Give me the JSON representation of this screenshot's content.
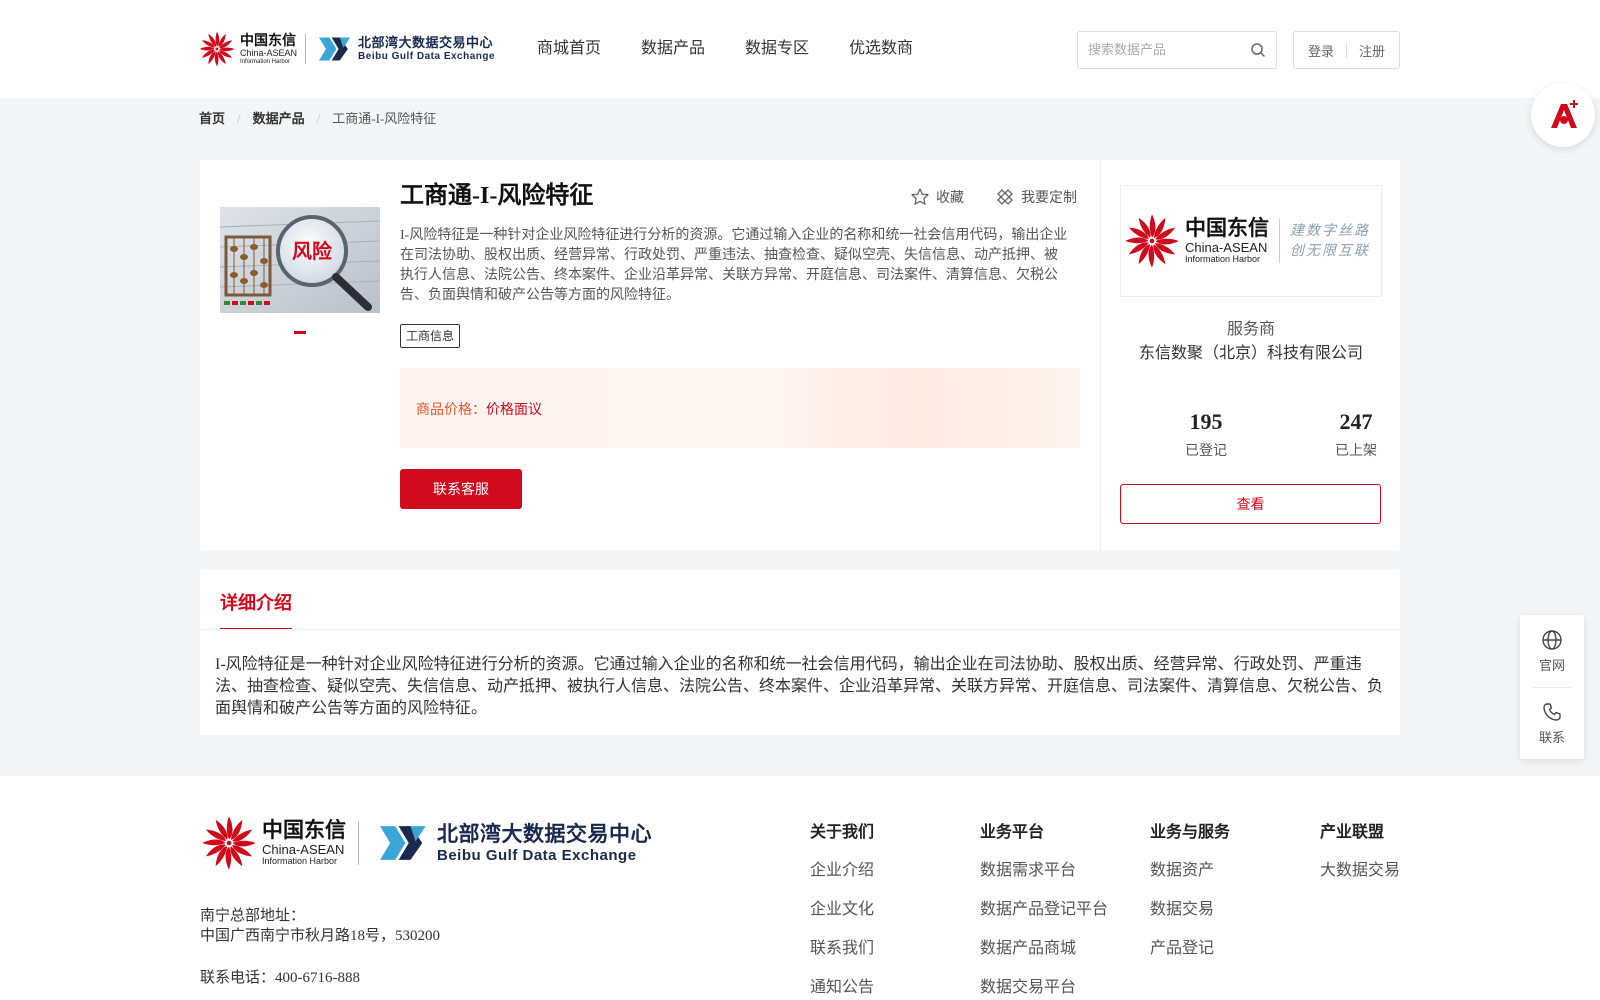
{
  "header": {
    "logo_cdx": {
      "cn": "中国东信",
      "en1": "China-ASEAN",
      "en2": "Information Harbor"
    },
    "logo_bbx": {
      "cn": "北部湾大数据交易中心",
      "en": "Beibu Gulf Data Exchange"
    },
    "nav": [
      "商城首页",
      "数据产品",
      "数据专区",
      "优选数商"
    ],
    "search_placeholder": "搜索数据产品",
    "login": "登录",
    "register": "注册"
  },
  "breadcrumb": {
    "home": "首页",
    "level1": "数据产品",
    "current": "工商通-I-风险特征",
    "separator": "/"
  },
  "product": {
    "title": "工商通-I-风险特征",
    "image_text": "风险",
    "favorite": "收藏",
    "customize": "我要定制",
    "description": "I-风险特征是一种针对企业风险特征进行分析的资源。它通过输入企业的名称和统一社会信用代码，输出企业在司法协助、股权出质、经营异常、行政处罚、严重违法、抽查检查、疑似空壳、失信信息、动产抵押、被执行人信息、法院公告、终本案件、企业沿革异常、关联方异常、开庭信息、司法案件、清算信息、欠税公告、负面舆情和破产公告等方面的风险特征。",
    "tag": "工商信息",
    "price_label": "商品价格：",
    "price_value": "价格面议",
    "contact_button": "联系客服"
  },
  "provider": {
    "logo_slogan_1": "建数字丝路",
    "logo_slogan_2": "创无限互联",
    "role": "服务商",
    "name": "东信数聚（北京）科技有限公司",
    "stats": [
      {
        "value": "195",
        "label": "已登记"
      },
      {
        "value": "247",
        "label": "已上架"
      }
    ],
    "view_button": "查看"
  },
  "detail": {
    "tab": "详细介绍",
    "text": "I-风险特征是一种针对企业风险特征进行分析的资源。它通过输入企业的名称和统一社会信用代码，输出企业在司法协助、股权出质、经营异常、行政处罚、严重违法、抽查检查、疑似空壳、失信信息、动产抵押、被执行人信息、法院公告、终本案件、企业沿革异常、关联方异常、开庭信息、司法案件、清算信息、欠税公告、负面舆情和破产公告等方面的风险特征。"
  },
  "side": {
    "website": "官网",
    "contact": "联系"
  },
  "footer": {
    "address_label": "南宁总部地址：",
    "address": "中国广西南宁市秋月路18号，530200",
    "phone": "联系电话：400-6716-888",
    "columns": [
      {
        "title": "关于我们",
        "links": [
          "企业介绍",
          "企业文化",
          "联系我们",
          "通知公告"
        ]
      },
      {
        "title": "业务平台",
        "links": [
          "数据需求平台",
          "数据产品登记平台",
          "数据产品商城",
          "数据交易平台"
        ]
      },
      {
        "title": "业务与服务",
        "links": [
          "数据资产",
          "数据交易",
          "产品登记"
        ]
      },
      {
        "title": "产业联盟",
        "links": [
          "大数据交易"
        ]
      }
    ]
  },
  "colors": {
    "brand_red": "#d0091c",
    "price_orange": "#e2552a",
    "bbx_navy": "#1a2a4f",
    "bbx_blue": "#3aa6d8"
  }
}
